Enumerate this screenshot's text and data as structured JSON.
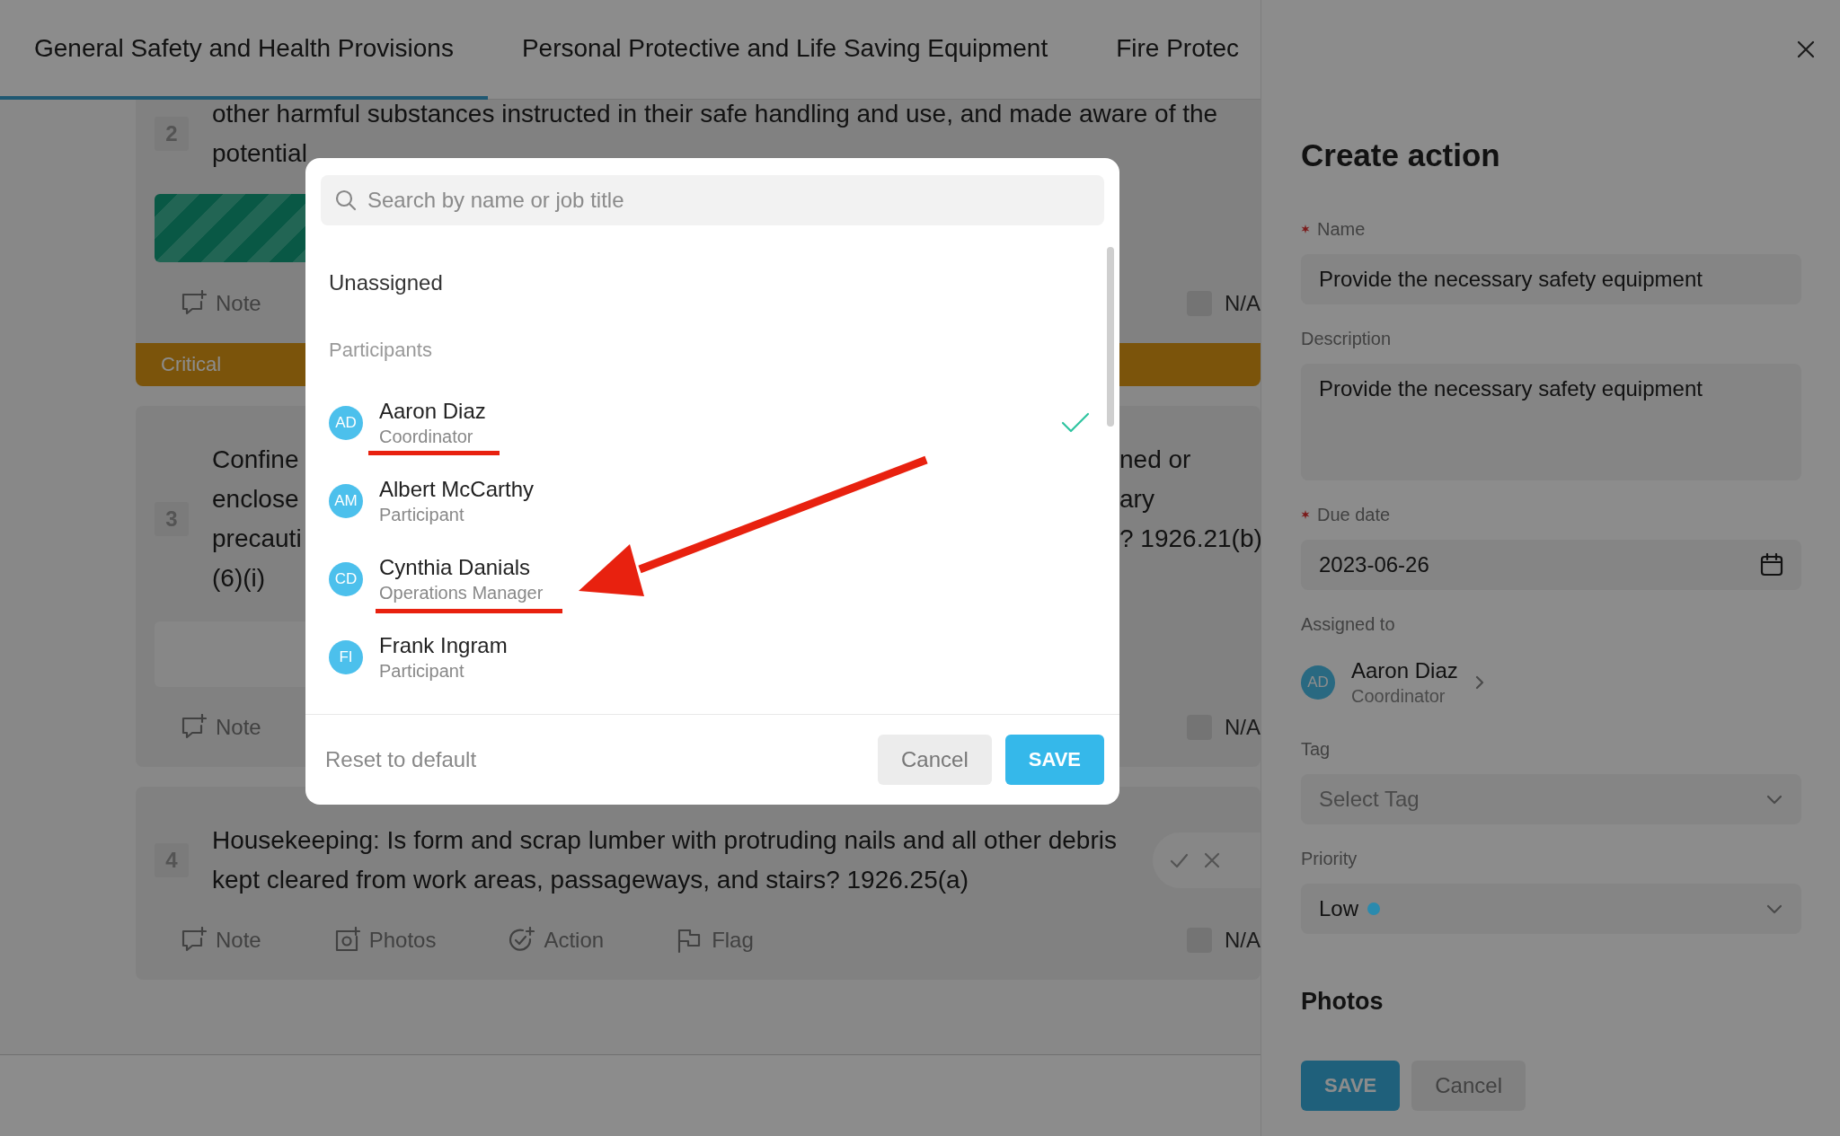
{
  "tabs": [
    {
      "label": "General Safety and Health Provisions",
      "selected": true
    },
    {
      "label": "Personal Protective and Life Saving Equipment",
      "selected": false
    },
    {
      "label": "Fire Protec",
      "selected": false
    }
  ],
  "cards": [
    {
      "number": "2",
      "lines": [
        "other harmful substances instructed in their safe handling and use, and made aware of the",
        "potential"
      ],
      "response": {
        "kind": "striped"
      },
      "actions": [
        {
          "kind": "note",
          "label": "Note"
        }
      ],
      "na_label": "N/A",
      "na_checked": false,
      "severity": "Critical"
    },
    {
      "number": "3",
      "lines": [
        "Confine",
        "enclose",
        "precauti",
        "(6)(i)"
      ],
      "right_lines": [
        "ned or",
        "ary",
        "? 1926.21(b)"
      ],
      "response": {
        "kind": "box"
      },
      "actions": [
        {
          "kind": "note",
          "label": "Note"
        }
      ],
      "na_label": "N/A",
      "na_checked": false
    },
    {
      "number": "4",
      "lines": [
        "Housekeeping: Is form and scrap lumber with protruding nails and all other debris",
        "kept cleared from work areas, passageways, and stairs? 1926.25(a)"
      ],
      "response": {
        "kind": "pill",
        "yes_selected": false,
        "no_selected": false
      },
      "actions": [
        {
          "kind": "note",
          "label": "Note"
        },
        {
          "kind": "photos",
          "label": "Photos"
        },
        {
          "kind": "action",
          "label": "Action"
        },
        {
          "kind": "flag",
          "label": "Flag"
        }
      ],
      "na_label": "N/A",
      "na_checked": false
    }
  ],
  "panel": {
    "title": "Create action",
    "fields": [
      {
        "kind": "text",
        "label": "Name",
        "required": true,
        "value": "Provide the necessary safety equipment"
      },
      {
        "kind": "textarea",
        "label": "Description",
        "required": false,
        "value": "Provide the necessary safety equipment"
      },
      {
        "kind": "date",
        "label": "Due date",
        "required": true,
        "value": "2023-06-26"
      },
      {
        "kind": "assignee",
        "label": "Assigned to",
        "required": false,
        "initials": "AD",
        "name": "Aaron Diaz",
        "role": "Coordinator"
      },
      {
        "kind": "select",
        "label": "Tag",
        "required": false,
        "placeholder": "Select Tag"
      },
      {
        "kind": "select",
        "label": "Priority",
        "required": false,
        "value": "Low",
        "color": "#2a8aae"
      }
    ],
    "section": "Photos",
    "buttons": [
      {
        "kind": "primary",
        "label": "SAVE"
      },
      {
        "kind": "secondary",
        "label": "Cancel"
      }
    ]
  },
  "assign_dialog": {
    "search_placeholder": "Search by name or job title",
    "unassigned_label": "Unassigned",
    "group_label": "Participants",
    "people": [
      {
        "initials": "AD",
        "name": "Aaron Diaz",
        "role": "Coordinator",
        "selected": true
      },
      {
        "initials": "AM",
        "name": "Albert McCarthy",
        "role": "Participant",
        "selected": false
      },
      {
        "initials": "CD",
        "name": "Cynthia Danials",
        "role": "Operations Manager",
        "selected": false
      },
      {
        "initials": "FI",
        "name": "Frank Ingram",
        "role": "Participant",
        "selected": false
      }
    ],
    "reset_label": "Reset to default",
    "buttons": [
      {
        "kind": "secondary",
        "label": "Cancel"
      },
      {
        "kind": "primary",
        "label": "SAVE"
      }
    ]
  }
}
